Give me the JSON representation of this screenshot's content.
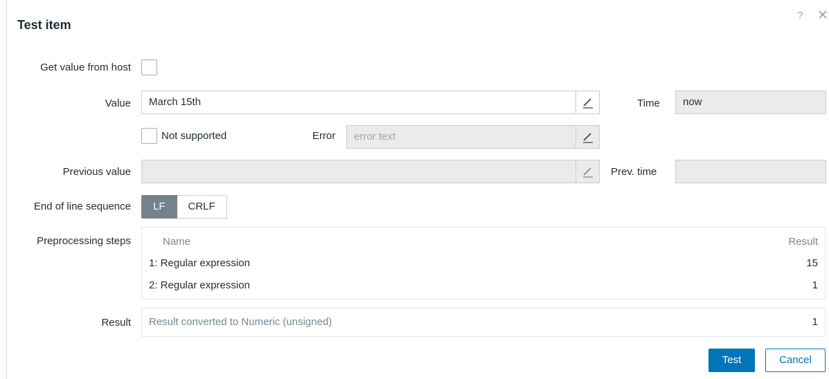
{
  "dialog": {
    "title": "Test item",
    "help_glyph": "?",
    "close_glyph": "✕"
  },
  "form": {
    "get_value_label": "Get value from host",
    "get_value_checked": false,
    "value_label": "Value",
    "value": "March 15th",
    "time_label": "Time",
    "time_value": "now",
    "not_supported_label": "Not supported",
    "not_supported_checked": false,
    "error_label": "Error",
    "error_placeholder": "error text",
    "previous_value_label": "Previous value",
    "previous_value": "",
    "prev_time_label": "Prev. time",
    "prev_time_value": "",
    "eol_label": "End of line sequence",
    "eol_options": [
      "LF",
      "CRLF"
    ],
    "eol_selected": "LF"
  },
  "preprocessing": {
    "label": "Preprocessing steps",
    "col_name": "Name",
    "col_result": "Result",
    "steps": [
      {
        "name": "1: Regular expression",
        "result": "15"
      },
      {
        "name": "2: Regular expression",
        "result": "1"
      }
    ]
  },
  "result": {
    "label": "Result",
    "description": "Result converted to Numeric (unsigned)",
    "value": "1"
  },
  "buttons": {
    "test": "Test",
    "cancel": "Cancel"
  },
  "icons": {
    "edit": "pencil-edit-icon",
    "help": "help-icon",
    "close": "close-icon"
  },
  "colors": {
    "primary": "#0275b8",
    "segment_active": "#76828a",
    "readonly_bg": "#ebebeb"
  }
}
